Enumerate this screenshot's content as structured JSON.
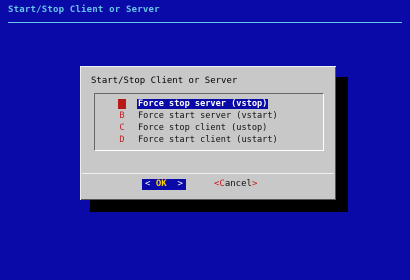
{
  "backtitle": "Start/Stop Client or Server",
  "dialog": {
    "title": "Start/Stop Client or Server",
    "menu": [
      {
        "tag": "A",
        "label": "Force stop server (vstop)",
        "selected": true
      },
      {
        "tag": "B",
        "label": "Force start server (vstart)",
        "selected": false
      },
      {
        "tag": "C",
        "label": "Force stop client (ustop)",
        "selected": false
      },
      {
        "tag": "D",
        "label": "Force start client (ustart)",
        "selected": false
      }
    ],
    "buttons": {
      "ok": {
        "left": "<",
        "hot": "OK",
        "right": ">"
      },
      "cancel": {
        "open": "<",
        "hot": "C",
        "rest": "ancel",
        "close": ">"
      }
    }
  },
  "colors": {
    "screen_bg": "#0a0aa8",
    "dialog_bg": "#c8c8c8",
    "accent_red": "#c41d1d",
    "hotkey_yellow": "#ffd400",
    "backtitle_cyan": "#67c7e6"
  }
}
